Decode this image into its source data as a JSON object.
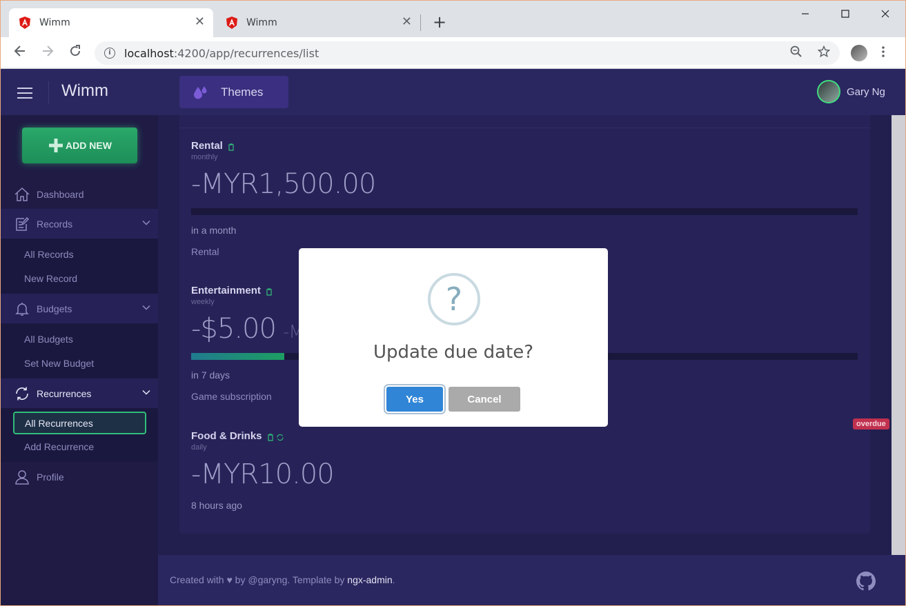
{
  "browser": {
    "tabs": [
      {
        "title": "Wimm",
        "active": true
      },
      {
        "title": "Wimm",
        "active": false
      }
    ],
    "url_host": "localhost",
    "url_path": ":4200/app/recurrences/list"
  },
  "header": {
    "brand": "Wimm",
    "themes_label": "Themes",
    "user_name": "Gary Ng"
  },
  "sidebar": {
    "add_new": "ADD NEW",
    "dashboard": "Dashboard",
    "records": "Records",
    "records_items": [
      "All Records",
      "New Record"
    ],
    "budgets": "Budgets",
    "budgets_items": [
      "All Budgets",
      "Set New Budget"
    ],
    "recurrences": "Recurrences",
    "recurrences_items": [
      "All Recurrences",
      "Add Recurrence"
    ],
    "profile": "Profile"
  },
  "recurrences": [
    {
      "name": "Rental",
      "frequency": "monthly",
      "amount": "-MYR1,500.00",
      "secondary_amount": "",
      "due": "in a month",
      "note": "Rental",
      "progress": 0
    },
    {
      "name": "Entertainment",
      "frequency": "weekly",
      "amount": "-$5.00",
      "secondary_amount": "-M",
      "due": "in 7 days",
      "note": "Game subscription",
      "progress": 0.14
    },
    {
      "name": "Food & Drinks",
      "frequency": "daily",
      "amount": "-MYR10.00",
      "secondary_amount": "",
      "due": "8 hours ago",
      "note": "",
      "badge": "overdue"
    }
  ],
  "footer": {
    "prefix": "Created with ♥ by @garyng. Template by ",
    "link": "ngx-admin",
    "suffix": "."
  },
  "modal": {
    "icon": "?",
    "title": "Update due date?",
    "confirm": "Yes",
    "cancel": "Cancel"
  },
  "colors": {
    "accent_green": "#40dc7e",
    "confirm_blue": "#3085d6",
    "overdue_red": "#c0314f",
    "bg_dark": "#1f1b45"
  }
}
